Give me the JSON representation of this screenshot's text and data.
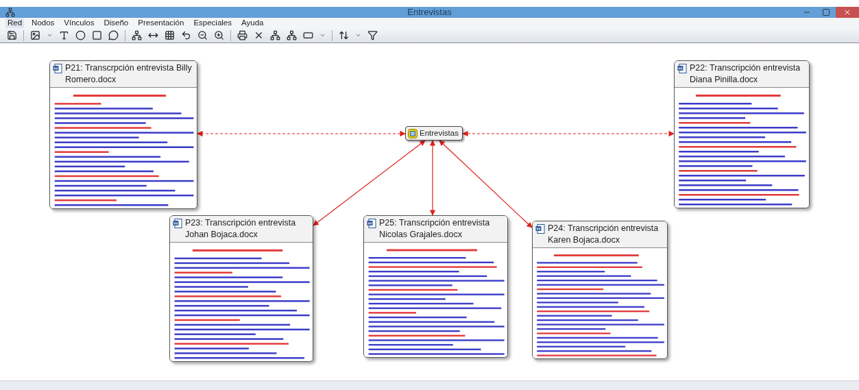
{
  "window": {
    "title": "Entrevistas"
  },
  "menu": [
    {
      "label": "Red",
      "selected": true
    },
    {
      "label": "Nodos",
      "selected": false
    },
    {
      "label": "Vínculos",
      "selected": false
    },
    {
      "label": "Diseño",
      "selected": false
    },
    {
      "label": "Presentación",
      "selected": false
    },
    {
      "label": "Especiales",
      "selected": false
    },
    {
      "label": "Ayuda",
      "selected": false
    }
  ],
  "network": {
    "hub": {
      "label": "Entrevistas"
    },
    "documents": [
      {
        "title": "P21: Transcrpción entrevista Billy Romero.docx"
      },
      {
        "title": "P22: Transcripción entrevista Diana Pinilla.docx"
      },
      {
        "title": "P23: Transcripción entrevista Johan Bojaca.docx"
      },
      {
        "title": "P25: Transcripción entrevista Nicolas Grajales.docx"
      },
      {
        "title": "P24: Transcripción entrevista Karen Bojaca.docx"
      }
    ]
  }
}
